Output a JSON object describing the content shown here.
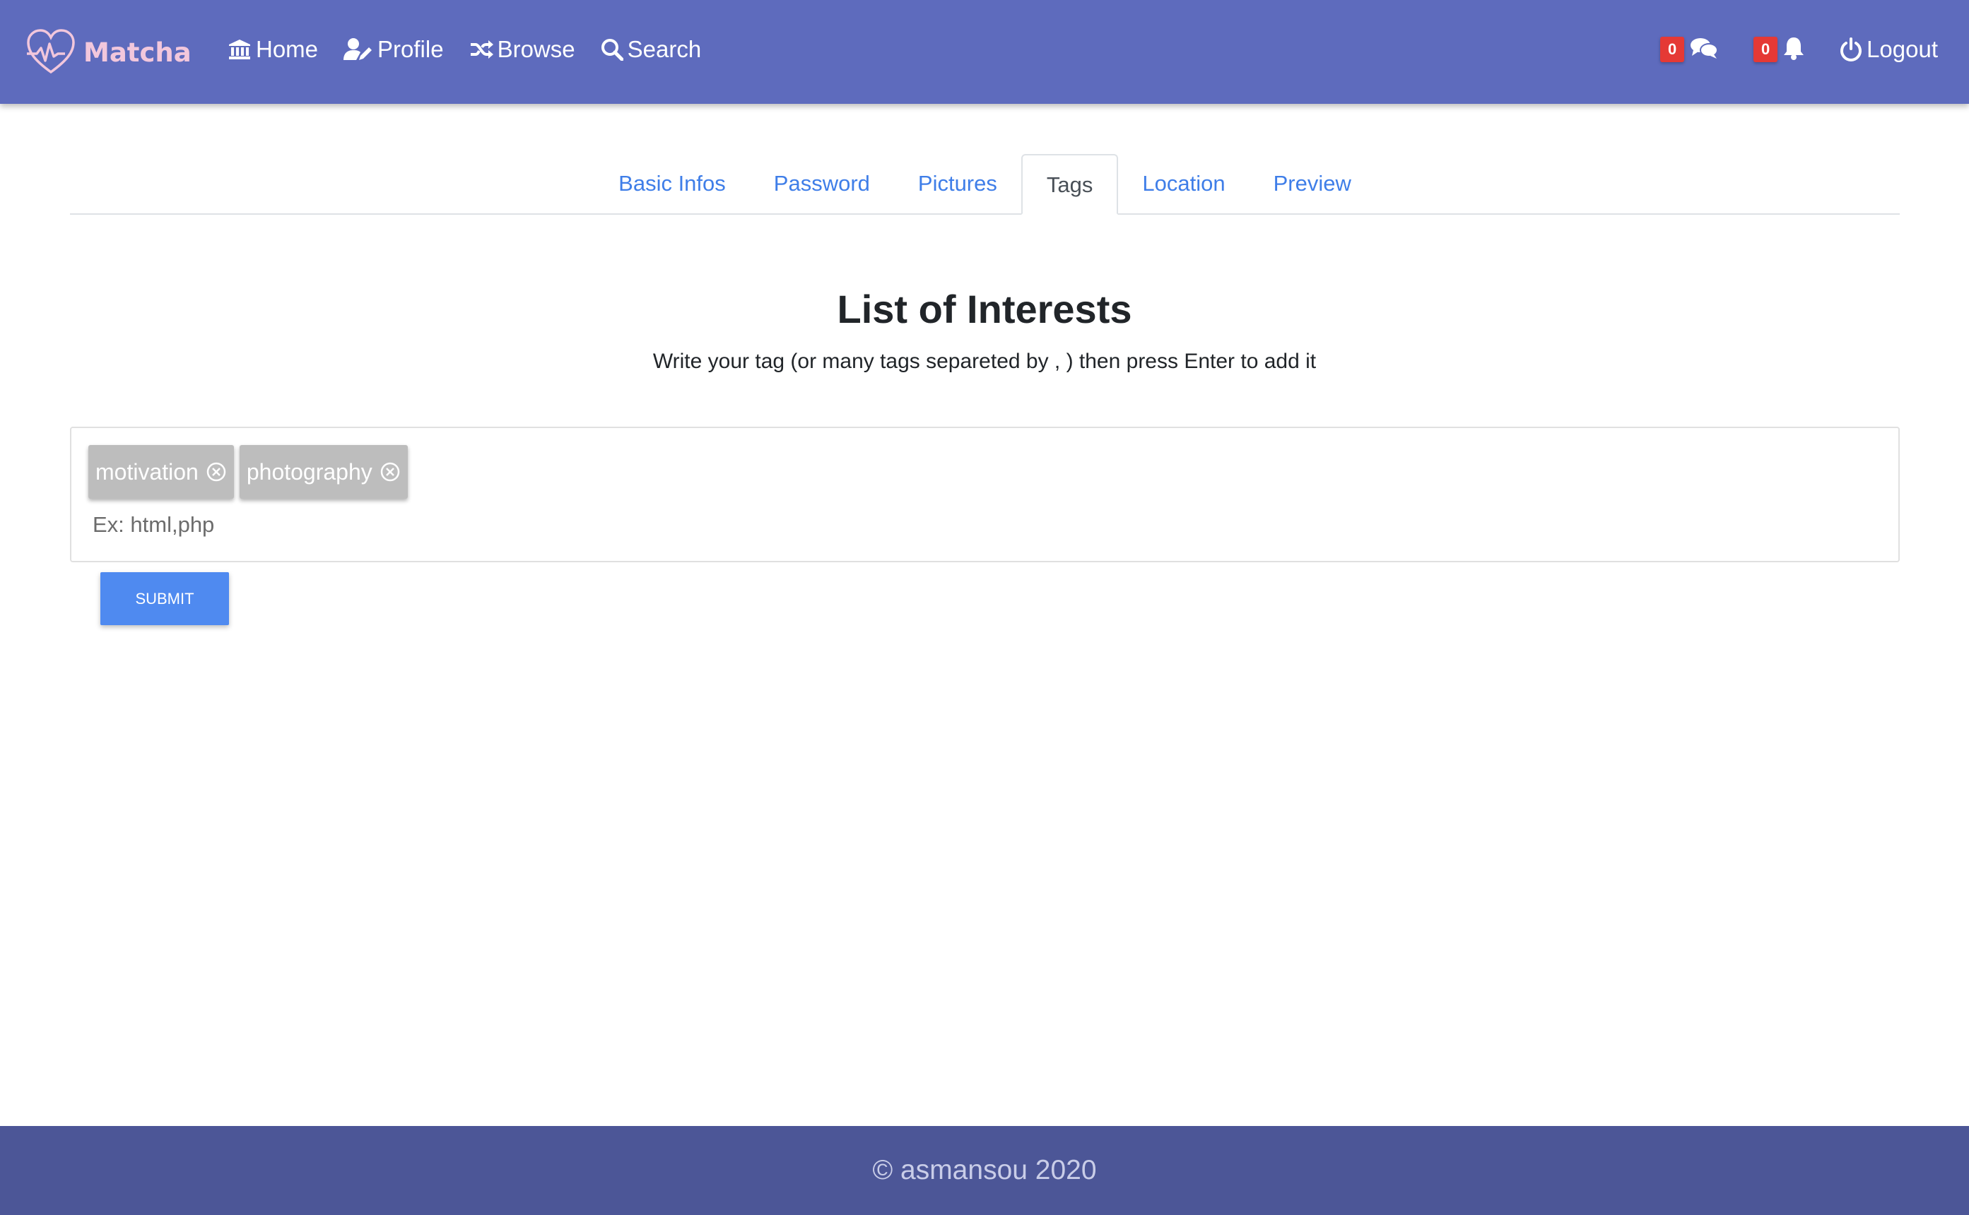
{
  "colors": {
    "navbar": "#5e6bbd",
    "footer": "#4c5697",
    "brand_text": "#f2c7dc",
    "tab_link": "#3f7ee8",
    "badge": "#e53935",
    "tag": "#bdbdbd",
    "submit": "#4f8af0"
  },
  "navbar": {
    "brand": {
      "icon": "heart-logo-icon",
      "label": "Matcha"
    },
    "links": [
      {
        "icon": "bank-icon",
        "label": "Home"
      },
      {
        "icon": "user-edit-icon",
        "label": "Profile"
      },
      {
        "icon": "shuffle-icon",
        "label": "Browse"
      },
      {
        "icon": "search-icon",
        "label": "Search"
      }
    ],
    "messages": {
      "icon": "comments-icon",
      "count": "0"
    },
    "notifications": {
      "icon": "bell-icon",
      "count": "0"
    },
    "logout": {
      "icon": "power-icon",
      "label": "Logout"
    }
  },
  "tabs": [
    {
      "label": "Basic Infos",
      "active": false
    },
    {
      "label": "Password",
      "active": false
    },
    {
      "label": "Pictures",
      "active": false
    },
    {
      "label": "Tags",
      "active": true
    },
    {
      "label": "Location",
      "active": false
    },
    {
      "label": "Preview",
      "active": false
    }
  ],
  "main": {
    "title": "List of Interests",
    "subtitle": "Write your tag (or many tags separeted by , ) then press Enter to add it",
    "tags": [
      {
        "label": "motivation",
        "remove_icon": "remove-circle-icon"
      },
      {
        "label": "photography",
        "remove_icon": "remove-circle-icon"
      }
    ],
    "input": {
      "value": "",
      "placeholder": "Ex: html,php"
    },
    "submit_label": "SUBMIT"
  },
  "footer": {
    "text": "© asmansou 2020"
  }
}
